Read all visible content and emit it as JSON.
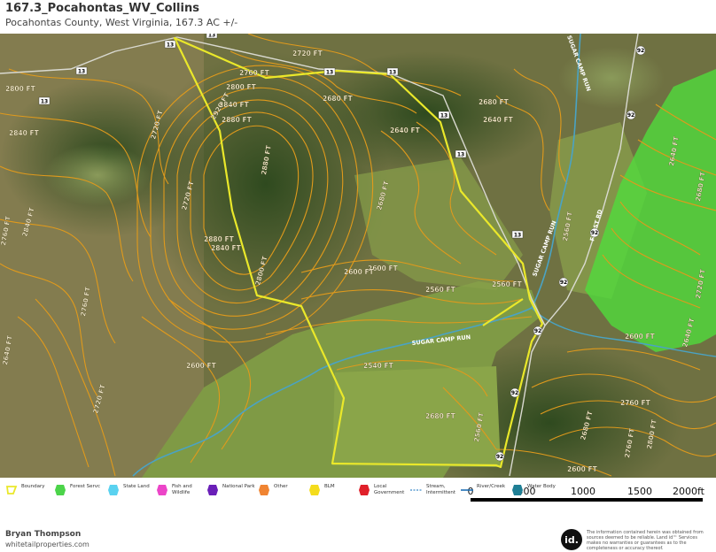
{
  "header": {
    "title": "167.3_Pocahontas_WV_Collins",
    "subtitle": "Pocahontas County, West Virginia, 167.3 AC +/-"
  },
  "map": {
    "contour_labels": [
      "2800 FT",
      "2840 FT",
      "2880 FT",
      "2920 FT",
      "2760 FT",
      "2720 FT",
      "2680 FT",
      "2640 FT",
      "2600 FT",
      "2560 FT",
      "2540 FT",
      "2800 FT",
      "2840 FT",
      "2880 FT",
      "2760 FT",
      "2720 FT",
      "2680 FT",
      "2640 FT",
      "2600 FT",
      "2560 FT",
      "2800 FT",
      "2840 FT",
      "2880 FT",
      "2760 FT",
      "2680 FT",
      "2640 FT",
      "2600 FT",
      "2560 FT",
      "2720 FT",
      "2680 FT",
      "2760 FT",
      "2800 FT",
      "2840 FT",
      "2720 FT",
      "2680 FT",
      "2640 FT",
      "2600 FT",
      "2640 FT",
      "2680 FT",
      "2720 FT",
      "2760 FT",
      "2560 FT",
      "2600 FT"
    ],
    "stream_labels": [
      "SUGAR CAMP RUN",
      "SUGAR CAMP RUN",
      "SUGAR CAMP RUN"
    ],
    "road_label": "FROST RD",
    "route_markers": [
      "13",
      "13",
      "13",
      "13",
      "13",
      "13",
      "13",
      "13",
      "13",
      "92",
      "92",
      "92",
      "92",
      "92",
      "92",
      "92"
    ],
    "colors": {
      "boundary": "#eae82a",
      "contour": "#e09a1c",
      "forest_service": "#4fde3c",
      "stream": "#4aa3c4"
    }
  },
  "scale": {
    "ticks": [
      "0",
      "500",
      "1000",
      "1500",
      "2000ft"
    ]
  },
  "legend": {
    "items": [
      {
        "label": "Boundary",
        "color": "#eae82a"
      },
      {
        "label": "Forest Servc",
        "color": "#4cd44a"
      },
      {
        "label": "State Land",
        "color": "#5ad2f0"
      },
      {
        "label": "Fish and Wildlife",
        "color": "#ec45c8"
      },
      {
        "label": "National Park",
        "color": "#6a1fb8"
      },
      {
        "label": "Other",
        "color": "#f08432"
      },
      {
        "label": "BLM",
        "color": "#f4dc1c"
      },
      {
        "label": "Local Government",
        "color": "#e0202a"
      },
      {
        "label": "Stream, Intermittent",
        "color": "#3e8bc9"
      },
      {
        "label": "River/Creek",
        "color": "#1e6fb5"
      },
      {
        "label": "Water Body",
        "color": "#1f7f95"
      }
    ]
  },
  "footer": {
    "name": "Bryan Thompson",
    "site": "whitetailproperties.com",
    "logo_text": "id.",
    "disclaimer": "The information contained herein was obtained from sources deemed to be reliable. Land id™ Services makes no warranties or guarantees as to the completeness or accuracy thereof."
  }
}
